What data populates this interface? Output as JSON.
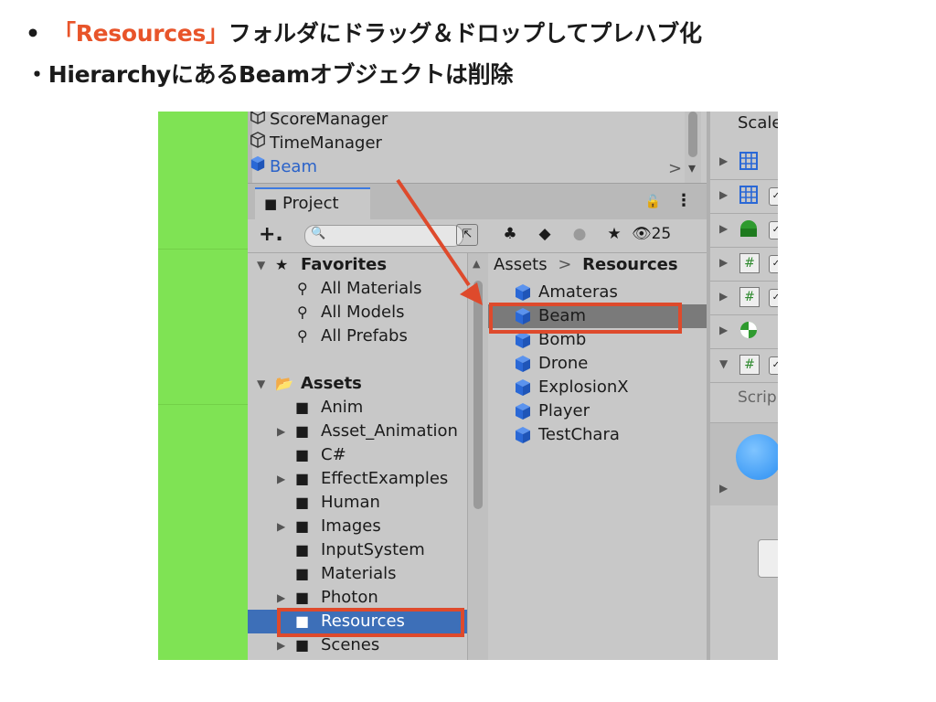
{
  "bullets": {
    "b1_dot": "•",
    "b1_accent": "「Resources」",
    "b1_rest": "フォルダにドラッグ＆ドロップしてプレハブ化",
    "b2_dot": "・",
    "b2_text": "HierarchyにあるBeamオブジェクトは削除"
  },
  "colors": {
    "accent": "#e8542a",
    "selection": "#3d6fb8",
    "cube": "#2a68d6",
    "scene_green": "#7fe354"
  },
  "hierarchy": {
    "items": [
      {
        "label": "ScoreManager",
        "icon": "cube-outline-icon"
      },
      {
        "label": "TimeManager",
        "icon": "cube-outline-icon"
      },
      {
        "label": "Beam",
        "icon": "prefab-cube-icon",
        "selected": true
      }
    ],
    "expand_glyph": ">",
    "dropdown_glyph": "▾"
  },
  "project": {
    "tab_label": "Project",
    "lock_glyph": "🔓",
    "menu_glyph": "⋮",
    "add_glyph": "+.",
    "search_placeholder": "",
    "search_icon": "🔍",
    "hidden_count": "25"
  },
  "tree": {
    "favorites": {
      "label": "Favorites",
      "items": [
        "All Materials",
        "All Models",
        "All Prefabs"
      ]
    },
    "assets": {
      "label": "Assets",
      "folders": [
        {
          "label": "Anim",
          "expandable": false
        },
        {
          "label": "Asset_Animation",
          "expandable": true
        },
        {
          "label": "C#",
          "expandable": false
        },
        {
          "label": "EffectExamples",
          "expandable": true
        },
        {
          "label": "Human",
          "expandable": false
        },
        {
          "label": "Images",
          "expandable": true
        },
        {
          "label": "InputSystem",
          "expandable": false
        },
        {
          "label": "Materials",
          "expandable": false
        },
        {
          "label": "Photon",
          "expandable": true
        },
        {
          "label": "Resources",
          "expandable": false,
          "selected": true
        },
        {
          "label": "Scenes",
          "expandable": true
        }
      ]
    }
  },
  "asset_panel": {
    "breadcrumb_root": "Assets",
    "breadcrumb_sep": ">",
    "breadcrumb_current": "Resources",
    "items": [
      "Amateras",
      "Beam",
      "Bomb",
      "Drone",
      "ExplosionX",
      "Player",
      "TestChara"
    ]
  },
  "inspector": {
    "scale_label": "Scale",
    "script_label": "Scrip",
    "component_icons": [
      "grid-icon",
      "grid-eye-icon",
      "sphere-half-icon",
      "script-hash-icon",
      "script-hash-icon",
      "pie-icon",
      "script-hash-icon"
    ],
    "hash_glyph": "#"
  }
}
